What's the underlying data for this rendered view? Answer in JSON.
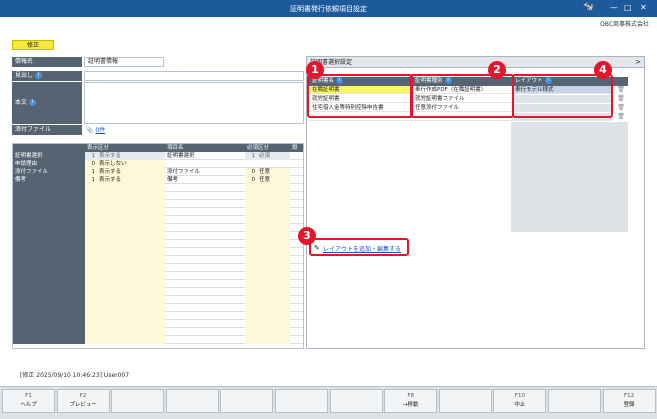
{
  "window": {
    "title": "証明書発行依頼項目設定",
    "company": "OBC商事株式会社"
  },
  "mode": "修正",
  "form": {
    "name_label": "情報名",
    "name_value": "証明書情報",
    "heading_label": "見出し",
    "body_label": "本文",
    "attach_label": "添付ファイル",
    "attach_count": "0件"
  },
  "left_grid": {
    "headers": [
      "表示区分",
      "項目名",
      "必須区分",
      "設"
    ],
    "rows": [
      {
        "label": "証明書選択",
        "code": "1",
        "display": "表示する",
        "item": "証明書選択",
        "req_code": "1",
        "req": "必須"
      },
      {
        "label": "申請理由",
        "code": "0",
        "display": "表示しない",
        "item": "",
        "req_code": "",
        "req": ""
      },
      {
        "label": "添付ファイル",
        "code": "1",
        "display": "表示する",
        "item": "添付ファイル",
        "req_code": "0",
        "req": "任意"
      },
      {
        "label": "備考",
        "code": "1",
        "display": "表示する",
        "item": "備考",
        "req_code": "0",
        "req": "任意"
      }
    ]
  },
  "right_panel": {
    "title": "証明書選択設定",
    "col_cert_name": "証明書名",
    "col_cert_type": "証明書種別",
    "col_layout": "レイアウト",
    "rows": [
      {
        "name": "在職証明書",
        "type": "奉行作成PDF（在職証明書）",
        "layout": "奉行モデル様式"
      },
      {
        "name": "就労証明書",
        "type": "就労証明書ファイル",
        "layout": ""
      },
      {
        "name": "住宅借入金等特別控除申告書",
        "type": "任意添付ファイル",
        "layout": ""
      }
    ],
    "link_text": "レイアウトを追加・編集する"
  },
  "badges": [
    "1",
    "2",
    "3",
    "4"
  ],
  "status_line": "[修正 2025/09/10 10:46:23] User007",
  "fkeys": [
    {
      "key": "F1",
      "label": "ヘルプ"
    },
    {
      "key": "F2",
      "label": "プレビュー"
    },
    {
      "key": "",
      "label": ""
    },
    {
      "key": "",
      "label": ""
    },
    {
      "key": "",
      "label": ""
    },
    {
      "key": "",
      "label": ""
    },
    {
      "key": "",
      "label": ""
    },
    {
      "key": "F8",
      "label": "→移動"
    },
    {
      "key": "",
      "label": ""
    },
    {
      "key": "F10",
      "label": "中止"
    },
    {
      "key": "",
      "label": ""
    },
    {
      "key": "F12",
      "label": "登録"
    }
  ]
}
